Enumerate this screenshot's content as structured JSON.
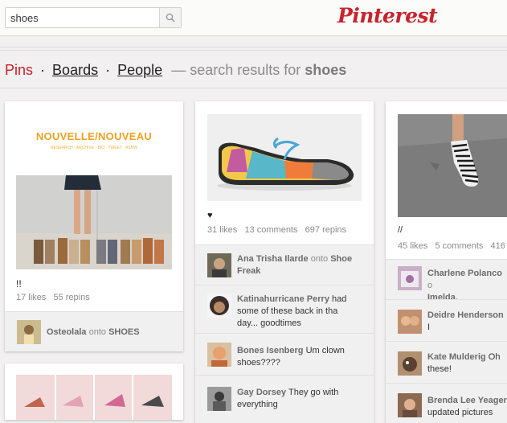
{
  "search": {
    "value": "shoes",
    "placeholder": "Search"
  },
  "logo": "Pinterest",
  "breadcrumb": {
    "pins": "Pins",
    "sep": "·",
    "boards": "Boards",
    "people": "People",
    "dash": "— search results for",
    "query": "shoes"
  },
  "pins": [
    {
      "brand_title": "NOUVELLE/NOUVEAU",
      "brand_nav": "RESEARCH · ARCHIVE · BIO · TWEET · ASHW",
      "description": "!!",
      "stats": "17 likes   55 repins",
      "activity": [
        {
          "user": "Osteolala",
          "onto": "onto",
          "board": "SHOES"
        }
      ]
    },
    {
      "description": "♥",
      "stats": "31 likes   13 comments   697 repins",
      "activity": [
        {
          "user": "Ana Trisha Ilarde",
          "onto": "onto",
          "board": "Shoe",
          "board2": "Freak"
        },
        {
          "user": "Katinahurricane Perry",
          "text1": "had",
          "text2": "some of these back in tha",
          "text3": "day... goodtimes"
        },
        {
          "user": "Bones Isenberg",
          "text1": "Um clown",
          "text2": "shoes????"
        },
        {
          "user": "Gay Dorsey",
          "text1": "They go with",
          "text2": "everything"
        }
      ]
    },
    {
      "description": "//",
      "stats": "45 likes   5 comments   416 r",
      "activity": [
        {
          "user": "Charlene Polanco",
          "onto": "o",
          "board": "Imelda."
        },
        {
          "user": "Deidre Henderson",
          "text1": "I"
        },
        {
          "user": "Kate Mulderig",
          "text1": "Oh",
          "text2": "these!"
        },
        {
          "user": "Brenda Lee Yeager",
          "text2": "updated pictures"
        }
      ]
    }
  ],
  "colors": {
    "brand_red": "#cb2027",
    "pin_bg": "#ffffff",
    "page_bg": "#f2f0f0"
  }
}
